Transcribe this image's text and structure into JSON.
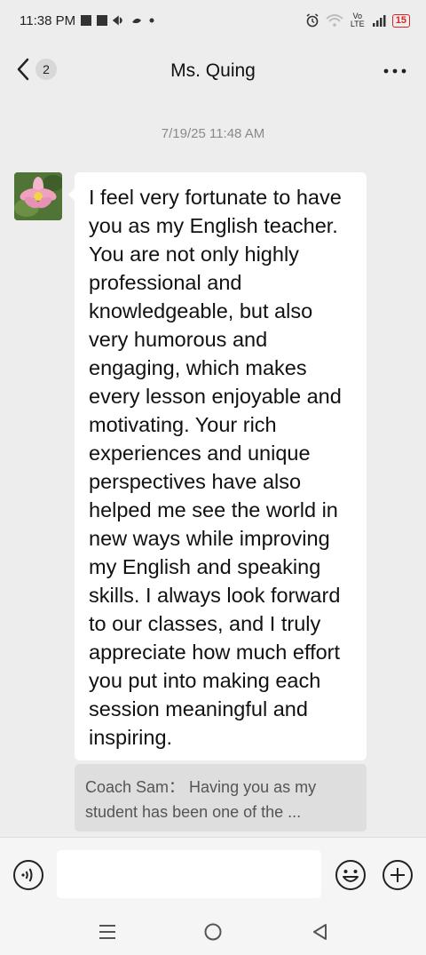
{
  "status_bar": {
    "time": "11:38 PM",
    "network_label": "Vo LTE",
    "battery": "15"
  },
  "header": {
    "back_badge": "2",
    "title": "Ms. Quing"
  },
  "chat": {
    "timestamp": "7/19/25 11:48 AM",
    "message": "I feel very fortunate to have you as my English teacher. You are not only highly professional and knowledgeable, but also very humorous and engaging, which makes every lesson enjoyable and motivating. Your rich experiences and unique perspectives have also helped me see the world in new ways while improving my English and speaking skills. I always look forward to our classes, and I truly appreciate how much effort you put into making each session meaningful and inspiring.",
    "quote": "Coach Sam： Having you as my student has been one of the ..."
  },
  "icons": {
    "back": "chevron-left-icon",
    "more": "more-icon",
    "voice": "voice-icon",
    "emoji": "emoji-icon",
    "plus": "plus-icon",
    "menu": "menu-icon",
    "home": "home-icon",
    "back_nav": "triangle-back-icon"
  },
  "colors": {
    "background": "#ededed",
    "bubble": "#ffffff",
    "quote": "#dedede",
    "battery": "#dd2222"
  }
}
